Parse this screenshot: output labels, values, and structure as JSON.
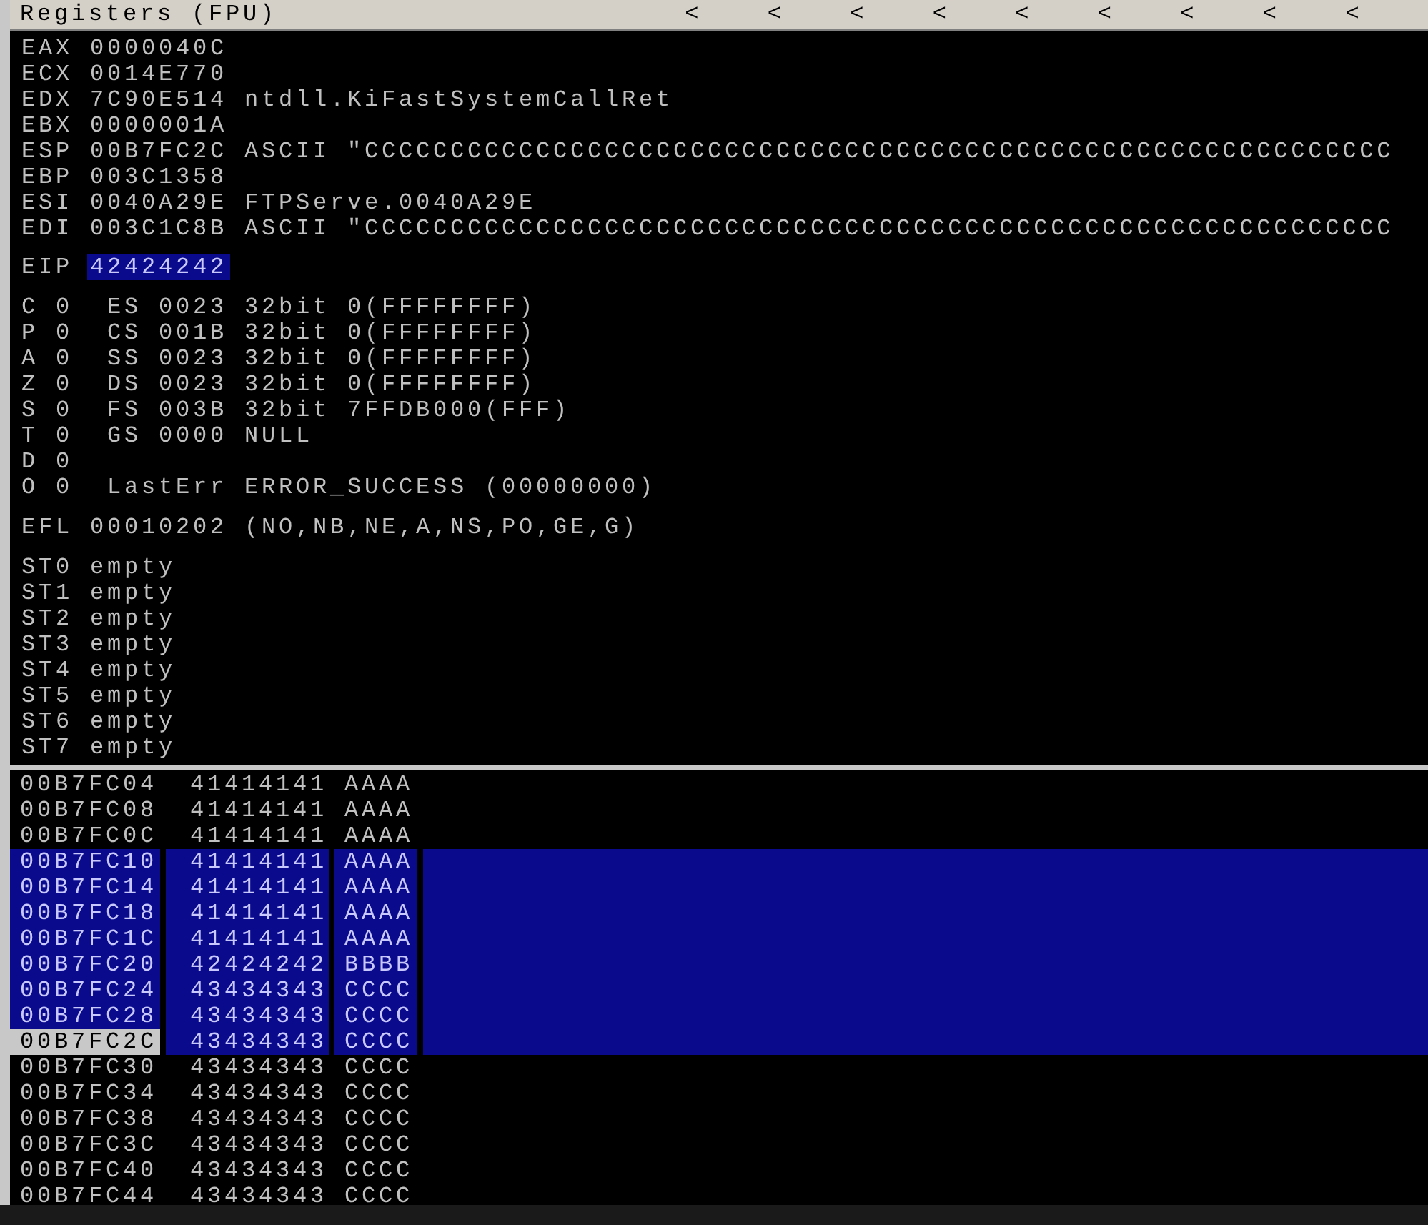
{
  "panel": {
    "title": "Registers (FPU)",
    "arrows": [
      "<",
      "<",
      "<",
      "<",
      "<",
      "<",
      "<",
      "<",
      "<"
    ]
  },
  "registers": [
    {
      "name": "EAX",
      "value": "0000040C"
    },
    {
      "name": "ECX",
      "value": "0014E770"
    },
    {
      "name": "EDX",
      "value": "7C90E514",
      "comment": "ntdll.KiFastSystemCallRet"
    },
    {
      "name": "EBX",
      "value": "0000001A"
    },
    {
      "name": "ESP",
      "value": "00B7FC2C",
      "comment": "ASCII \"CCCCCCCCCCCCCCCCCCCCCCCCCCCCCCCCCCCCCCCCCCCCCCCCCCCCCCCCCCCC"
    },
    {
      "name": "EBP",
      "value": "003C1358"
    },
    {
      "name": "ESI",
      "value": "0040A29E",
      "comment": "FTPServe.0040A29E"
    },
    {
      "name": "EDI",
      "value": "003C1C8B",
      "comment": "ASCII \"CCCCCCCCCCCCCCCCCCCCCCCCCCCCCCCCCCCCCCCCCCCCCCCCCCCCCCCCCCCC"
    }
  ],
  "eip": {
    "name": "EIP",
    "value": "42424242",
    "selected": true
  },
  "flags": [
    {
      "flag": "C",
      "value": "0",
      "detail": "ES 0023 32bit 0(FFFFFFFF)"
    },
    {
      "flag": "P",
      "value": "0",
      "detail": "CS 001B 32bit 0(FFFFFFFF)"
    },
    {
      "flag": "A",
      "value": "0",
      "detail": "SS 0023 32bit 0(FFFFFFFF)"
    },
    {
      "flag": "Z",
      "value": "0",
      "detail": "DS 0023 32bit 0(FFFFFFFF)"
    },
    {
      "flag": "S",
      "value": "0",
      "detail": "FS 003B 32bit 7FFDB000(FFF)"
    },
    {
      "flag": "T",
      "value": "0",
      "detail": "GS 0000 NULL"
    },
    {
      "flag": "D",
      "value": "0"
    },
    {
      "flag": "O",
      "value": "0",
      "detail": "LastErr ERROR_SUCCESS (00000000)"
    }
  ],
  "efl": {
    "name": "EFL",
    "value": "00010202",
    "decoded": "(NO,NB,NE,A,NS,PO,GE,G)"
  },
  "fpu": [
    {
      "name": "ST0",
      "value": "empty"
    },
    {
      "name": "ST1",
      "value": "empty"
    },
    {
      "name": "ST2",
      "value": "empty"
    },
    {
      "name": "ST3",
      "value": "empty"
    },
    {
      "name": "ST4",
      "value": "empty"
    },
    {
      "name": "ST5",
      "value": "empty"
    },
    {
      "name": "ST6",
      "value": "empty"
    },
    {
      "name": "ST7",
      "value": "empty"
    }
  ],
  "stack": [
    {
      "address": "00B7FC04",
      "value": "41414141",
      "ascii": "AAAA",
      "selected": false,
      "current": false
    },
    {
      "address": "00B7FC08",
      "value": "41414141",
      "ascii": "AAAA",
      "selected": false,
      "current": false
    },
    {
      "address": "00B7FC0C",
      "value": "41414141",
      "ascii": "AAAA",
      "selected": false,
      "current": false
    },
    {
      "address": "00B7FC10",
      "value": "41414141",
      "ascii": "AAAA",
      "selected": true,
      "current": false
    },
    {
      "address": "00B7FC14",
      "value": "41414141",
      "ascii": "AAAA",
      "selected": true,
      "current": false
    },
    {
      "address": "00B7FC18",
      "value": "41414141",
      "ascii": "AAAA",
      "selected": true,
      "current": false
    },
    {
      "address": "00B7FC1C",
      "value": "41414141",
      "ascii": "AAAA",
      "selected": true,
      "current": false
    },
    {
      "address": "00B7FC20",
      "value": "42424242",
      "ascii": "BBBB",
      "selected": true,
      "current": false
    },
    {
      "address": "00B7FC24",
      "value": "43434343",
      "ascii": "CCCC",
      "selected": true,
      "current": false
    },
    {
      "address": "00B7FC28",
      "value": "43434343",
      "ascii": "CCCC",
      "selected": true,
      "current": false
    },
    {
      "address": "00B7FC2C",
      "value": "43434343",
      "ascii": "CCCC",
      "selected": true,
      "current": true
    },
    {
      "address": "00B7FC30",
      "value": "43434343",
      "ascii": "CCCC",
      "selected": false,
      "current": false
    },
    {
      "address": "00B7FC34",
      "value": "43434343",
      "ascii": "CCCC",
      "selected": false,
      "current": false
    },
    {
      "address": "00B7FC38",
      "value": "43434343",
      "ascii": "CCCC",
      "selected": false,
      "current": false
    },
    {
      "address": "00B7FC3C",
      "value": "43434343",
      "ascii": "CCCC",
      "selected": false,
      "current": false
    },
    {
      "address": "00B7FC40",
      "value": "43434343",
      "ascii": "CCCC",
      "selected": false,
      "current": false
    },
    {
      "address": "00B7FC44",
      "value": "43434343",
      "ascii": "CCCC",
      "selected": false,
      "current": false
    }
  ]
}
